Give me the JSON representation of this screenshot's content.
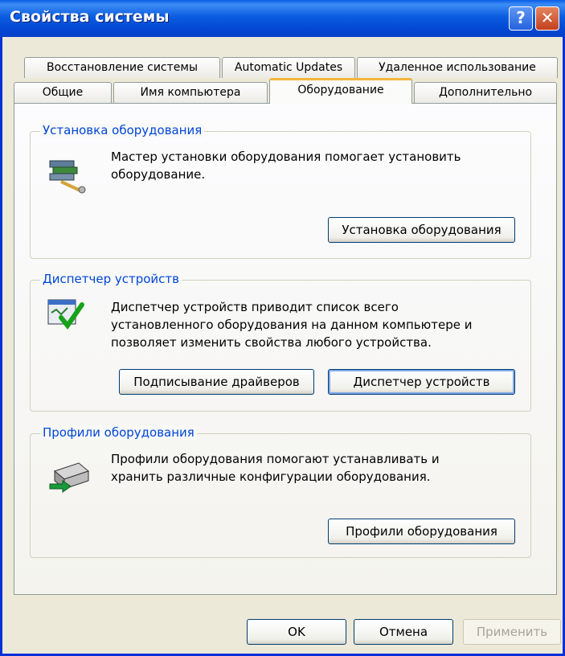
{
  "window": {
    "title": "Свойства системы",
    "help_glyph": "?",
    "close_glyph": "✕"
  },
  "tabs_row1": [
    {
      "label": "Восстановление системы"
    },
    {
      "label": "Automatic Updates"
    },
    {
      "label": "Удаленное использование"
    }
  ],
  "tabs_row2": [
    {
      "label": "Общие"
    },
    {
      "label": "Имя компьютера"
    },
    {
      "label": "Оборудование",
      "active": true
    },
    {
      "label": "Дополнительно"
    }
  ],
  "groups": {
    "install": {
      "title": "Установка оборудования",
      "description": [
        "Мастер установки оборудования помогает установить",
        "оборудование."
      ],
      "button": "Установка оборудования",
      "icon": "hardware-wizard-icon"
    },
    "device_manager": {
      "title": "Диспетчер устройств",
      "description": [
        "Диспетчер устройств приводит список всего",
        "установленного оборудования на данном компьютере и",
        "позволяет изменить свойства любого устройства."
      ],
      "button_signing": "Подписывание драйверов",
      "button_manager": "Диспетчер устройств",
      "icon": "device-manager-icon"
    },
    "profiles": {
      "title": "Профили оборудования",
      "description": [
        "Профили оборудования помогают устанавливать и",
        "хранить различные конфигурации оборудования."
      ],
      "button": "Профили оборудования",
      "icon": "hardware-profiles-icon"
    }
  },
  "footer": {
    "ok": "OK",
    "cancel": "Отмена",
    "apply": "Применить"
  }
}
